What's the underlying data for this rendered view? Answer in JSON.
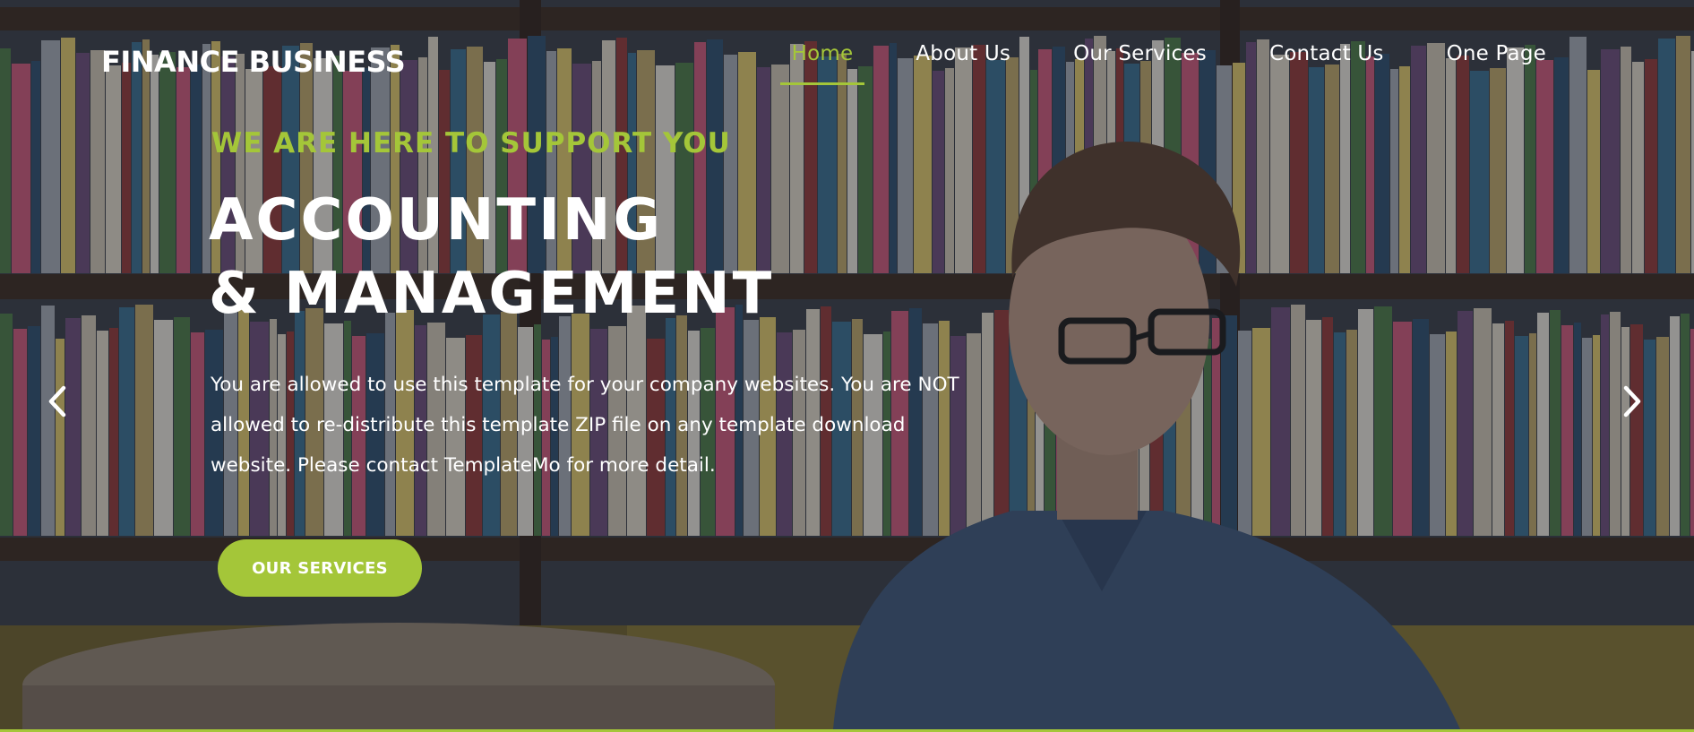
{
  "header": {
    "logo": "FINANCE BUSINESS",
    "nav": [
      {
        "label": "Home",
        "active": true
      },
      {
        "label": "About Us",
        "active": false
      },
      {
        "label": "Our Services",
        "active": false
      },
      {
        "label": "Contact Us",
        "active": false
      },
      {
        "label": "One Page",
        "active": false
      }
    ]
  },
  "hero": {
    "kicker": "WE ARE HERE TO SUPPORT YOU",
    "headline_line1": "ACCOUNTING",
    "headline_line2": "& MANAGEMENT",
    "description": "You are allowed to use this template for your company websites. You are NOT allowed to re-distribute this template ZIP file on any template download website. Please contact TemplateMo for more detail.",
    "cta_label": "OUR SERVICES"
  },
  "slider": {
    "prev_icon": "chevron-left-icon",
    "next_icon": "chevron-right-icon"
  },
  "colors": {
    "accent": "#a4c639",
    "text": "#ffffff"
  }
}
